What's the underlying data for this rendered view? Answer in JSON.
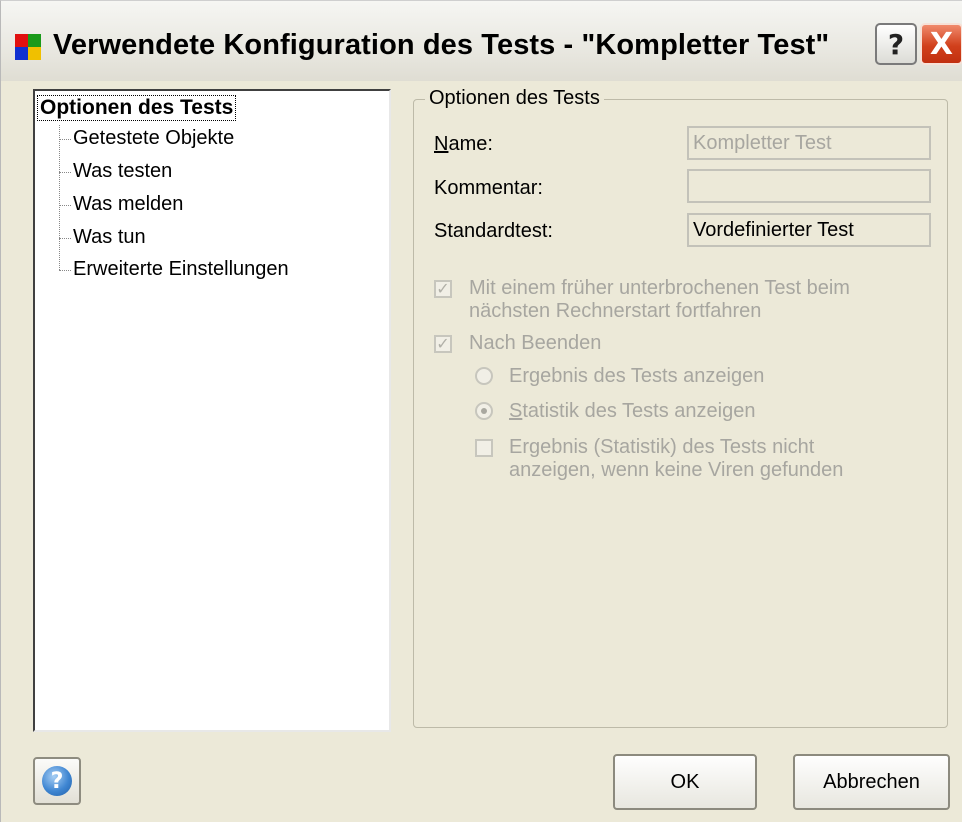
{
  "window": {
    "title": "Verwendete Konfiguration des Tests - \"Kompletter Test\"",
    "help_title_glyph": "?",
    "close_glyph": "X",
    "app_icon_colors": [
      "#e01010",
      "#1a9a1a",
      "#1030d0",
      "#f0c000"
    ]
  },
  "tree": {
    "root": "Optionen des Tests",
    "children": [
      "Getestete Objekte",
      "Was testen",
      "Was melden",
      "Was tun",
      "Erweiterte Einstellungen"
    ]
  },
  "group": {
    "title": "Optionen des Tests",
    "name_label": "Name:",
    "name_label_mnemonic": "N",
    "name_label_rest": "ame:",
    "name_value": "Kompletter Test",
    "comment_label": "Kommentar:",
    "comment_value": "",
    "standard_label": "Standardtest:",
    "standard_value": "Vordefinierter Test"
  },
  "options": {
    "resume_checkbox": {
      "checked": true,
      "line1": "Mit einem früher unterbrochenen Test beim",
      "line2": "nächsten Rechnerstart fortfahren"
    },
    "after_finish_checkbox": {
      "checked": true,
      "label": "Nach Beenden"
    },
    "show_result_radio": {
      "selected": false,
      "label": "Ergebnis des Tests anzeigen"
    },
    "show_stats_radio": {
      "selected": true,
      "mnemonic": "S",
      "label_rest": "tatistik des Tests anzeigen",
      "label": "Statistik des Tests anzeigen"
    },
    "no_result_checkbox": {
      "checked": false,
      "line1": "Ergebnis (Statistik) des Tests nicht",
      "line2": "anzeigen, wenn keine Viren gefunden"
    },
    "check_glyph": "✓"
  },
  "buttons": {
    "help_glyph": "?",
    "ok": "OK",
    "cancel": "Abbrechen"
  },
  "colors": {
    "dialog_bg": "#ece9d8",
    "disabled_text": "#a7a6a0",
    "close_button": "#d1401c"
  }
}
